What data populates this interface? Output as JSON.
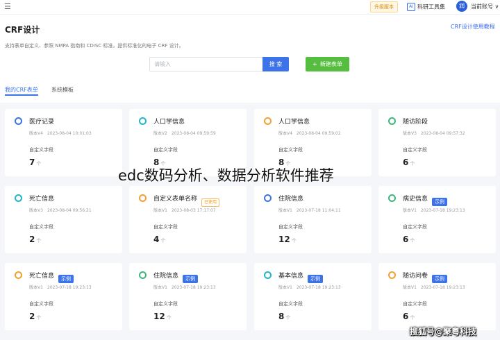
{
  "topbar": {
    "upgrade_label": "升级版本",
    "ai_badge": "AI",
    "ai_tools_label": "科研工具集",
    "avatar_text": "润",
    "account_label": "当前账号 ∨"
  },
  "header": {
    "title": "CRF设计",
    "help_link": "CRF设计使用教程",
    "description": "支持表单自定义、参照 NMPA 指南和 CDISC 标准，提供标准化的电子 CRF 设计。"
  },
  "toolbar": {
    "search_placeholder": "请输入",
    "search_button": "搜 索",
    "new_button": "新建表单",
    "new_plus": "+"
  },
  "tabs": [
    {
      "label": "我的CRF表单",
      "active": true
    },
    {
      "label": "系统模板",
      "active": false
    }
  ],
  "colors": {
    "accent": "#3d73e8",
    "green": "#55bd3f",
    "icon_blue": "#3d73e8",
    "icon_teal": "#20b6c4",
    "icon_orange": "#f0a12e",
    "icon_green": "#3fb57e"
  },
  "cards": [
    {
      "title": "医疗记录",
      "version": "版本V4",
      "date": "2023-08-04 10:01:03",
      "field_label": "自定义字段",
      "count": "7",
      "unit": "个",
      "icon": "form-icon",
      "icon_color": "#3d73e8",
      "tag": ""
    },
    {
      "title": "人口学信息",
      "version": "版本V2",
      "date": "2023-08-04 09:59:59",
      "field_label": "自定义字段",
      "count": "8",
      "unit": "个",
      "icon": "form-icon",
      "icon_color": "#20b6c4",
      "tag": ""
    },
    {
      "title": "人口学信息",
      "version": "版本V4",
      "date": "2023-08-04 09:59:02",
      "field_label": "自定义字段",
      "count": "8",
      "unit": "个",
      "icon": "form-icon",
      "icon_color": "#f0a12e",
      "tag": ""
    },
    {
      "title": "随访阶段",
      "version": "版本V3",
      "date": "2023-08-04 09:57:32",
      "field_label": "自定义字段",
      "count": "6",
      "unit": "个",
      "icon": "form-icon",
      "icon_color": "#3fb57e",
      "tag": ""
    },
    {
      "title": "死亡信息",
      "version": "版本V3",
      "date": "2023-08-04 09:56:21",
      "field_label": "自定义字段",
      "count": "2",
      "unit": "个",
      "icon": "form-icon",
      "icon_color": "#20b6c4",
      "tag": ""
    },
    {
      "title": "自定义表单名称",
      "version": "版本V1",
      "date": "2023-08-03 17:17:07",
      "field_label": "自定义字段",
      "count": "4",
      "unit": "个",
      "icon": "form-icon",
      "icon_color": "#f0a12e",
      "tag": "已使用"
    },
    {
      "title": "住院信息",
      "version": "版本V1",
      "date": "2023-07-18 11:04:11",
      "field_label": "自定义字段",
      "count": "12",
      "unit": "个",
      "icon": "form-icon",
      "icon_color": "#3d73e8",
      "tag": ""
    },
    {
      "title": "病史信息",
      "version": "版本V1",
      "date": "2023-07-18 19:23:13",
      "field_label": "自定义字段",
      "count": "6",
      "unit": "个",
      "icon": "form-icon",
      "icon_color": "#3fb57e",
      "tag": "示例"
    },
    {
      "title": "死亡信息",
      "version": "版本V1",
      "date": "2023-07-18 19:23:13",
      "field_label": "自定义字段",
      "count": "2",
      "unit": "个",
      "icon": "form-icon",
      "icon_color": "#f0a12e",
      "tag": "示例"
    },
    {
      "title": "住院信息",
      "version": "版本V1",
      "date": "2023-07-18 19:23:13",
      "field_label": "自定义字段",
      "count": "12",
      "unit": "个",
      "icon": "form-icon",
      "icon_color": "#3fb57e",
      "tag": "示例"
    },
    {
      "title": "基本信息",
      "version": "版本V1",
      "date": "2023-07-18 19:23:13",
      "field_label": "自定义字段",
      "count": "8",
      "unit": "个",
      "icon": "form-icon",
      "icon_color": "#20b6c4",
      "tag": "示例"
    },
    {
      "title": "随访问卷",
      "version": "版本V1",
      "date": "2023-07-18 19:23:13",
      "field_label": "自定义字段",
      "count": "6",
      "unit": "个",
      "icon": "form-icon",
      "icon_color": "#f0a12e",
      "tag": "示例"
    }
  ],
  "overlay": {
    "caption": "edc数码分析、数据分析软件推荐",
    "source": "搜狐号@聚粤科技"
  }
}
